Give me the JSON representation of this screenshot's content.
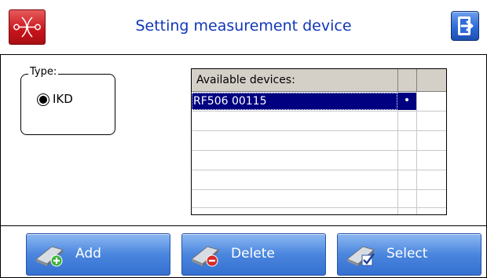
{
  "header": {
    "title": "Setting measurement device",
    "logo_icon": "logo-icon",
    "exit_icon": "exit-icon"
  },
  "type_group": {
    "legend": "Type:",
    "options": [
      {
        "label": "IKD",
        "selected": true
      }
    ]
  },
  "devices_table": {
    "header": "Available devices:",
    "rows": [
      {
        "name": "RF506 00115",
        "selected": true,
        "mark": "•"
      }
    ]
  },
  "actions": {
    "add_label": "Add",
    "delete_label": "Delete",
    "select_label": "Select"
  },
  "colors": {
    "title": "#1036b8",
    "button": "#4a86de",
    "selection": "#000080",
    "logo": "#c8141b"
  }
}
